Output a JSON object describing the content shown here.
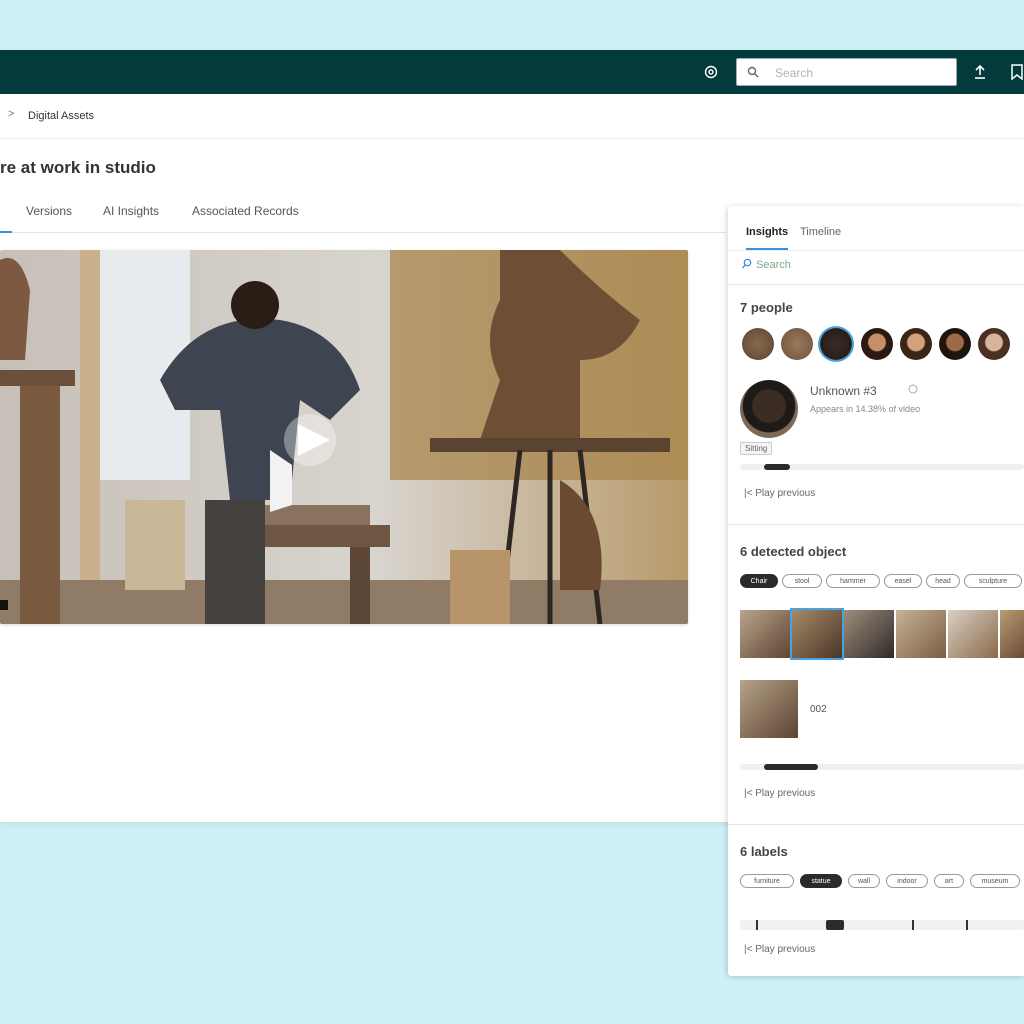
{
  "topbar": {
    "search_placeholder": "Search"
  },
  "breadcrumb": {
    "item": "Digital Assets"
  },
  "page": {
    "title": "re at work in studio"
  },
  "tabs": [
    "Versions",
    "AI Insights",
    "Associated Records"
  ],
  "panel": {
    "tabs": [
      "Insights",
      "Timeline"
    ],
    "search_label": "Search",
    "people": {
      "title": "7 people",
      "selected": {
        "name": "Unknown #3",
        "sub": "Appears in 14.38% of video",
        "tag": "Sitting"
      },
      "play_previous": "|< Play previous"
    },
    "objects": {
      "title": "6 detected object",
      "chips": [
        "Chair",
        "stool",
        "hammer",
        "easel",
        "head",
        "sculpture"
      ],
      "active_chip": "Chair",
      "selected_label": "002",
      "play_previous": "|< Play previous"
    },
    "labels": {
      "title": "6 labels",
      "chips": [
        "furniture",
        "statue",
        "wall",
        "indoor",
        "art",
        "museum"
      ],
      "active_chip": "statue",
      "play_previous": "|< Play previous"
    }
  },
  "colors": {
    "topbar": "#033a3b",
    "accent": "#3a8fd6",
    "background": "#cdf1f6"
  }
}
